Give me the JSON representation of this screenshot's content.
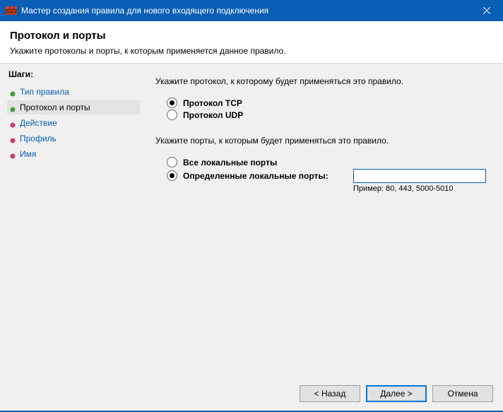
{
  "window": {
    "title": "Мастер создания правила для нового входящего подключения"
  },
  "header": {
    "title": "Протокол и порты",
    "subtitle": "Укажите протоколы и порты, к которым применяется данное правило."
  },
  "sidebar": {
    "heading": "Шаги:",
    "steps": [
      {
        "label": "Тип правила",
        "color": "#3aa039"
      },
      {
        "label": "Протокол и порты",
        "color": "#3aa039"
      },
      {
        "label": "Действие",
        "color": "#cc3b77"
      },
      {
        "label": "Профиль",
        "color": "#cc3b77"
      },
      {
        "label": "Имя",
        "color": "#cc3b77"
      }
    ],
    "activeIndex": 1
  },
  "content": {
    "protocolInstruction": "Укажите протокол, к которому будет применяться это правило.",
    "protocolTCP": "Протокол TCP",
    "protocolUDP": "Протокол UDP",
    "portsInstruction": "Укажите порты, к которым будет применяться это правило.",
    "allPortsLabel": "Все локальные порты",
    "specificPortsLabel": "Определенные локальные порты:",
    "portsValue": "",
    "portsHint": "Пример: 80, 443, 5000-5010"
  },
  "footer": {
    "back": "< Назад",
    "next": "Далее >",
    "cancel": "Отмена"
  }
}
